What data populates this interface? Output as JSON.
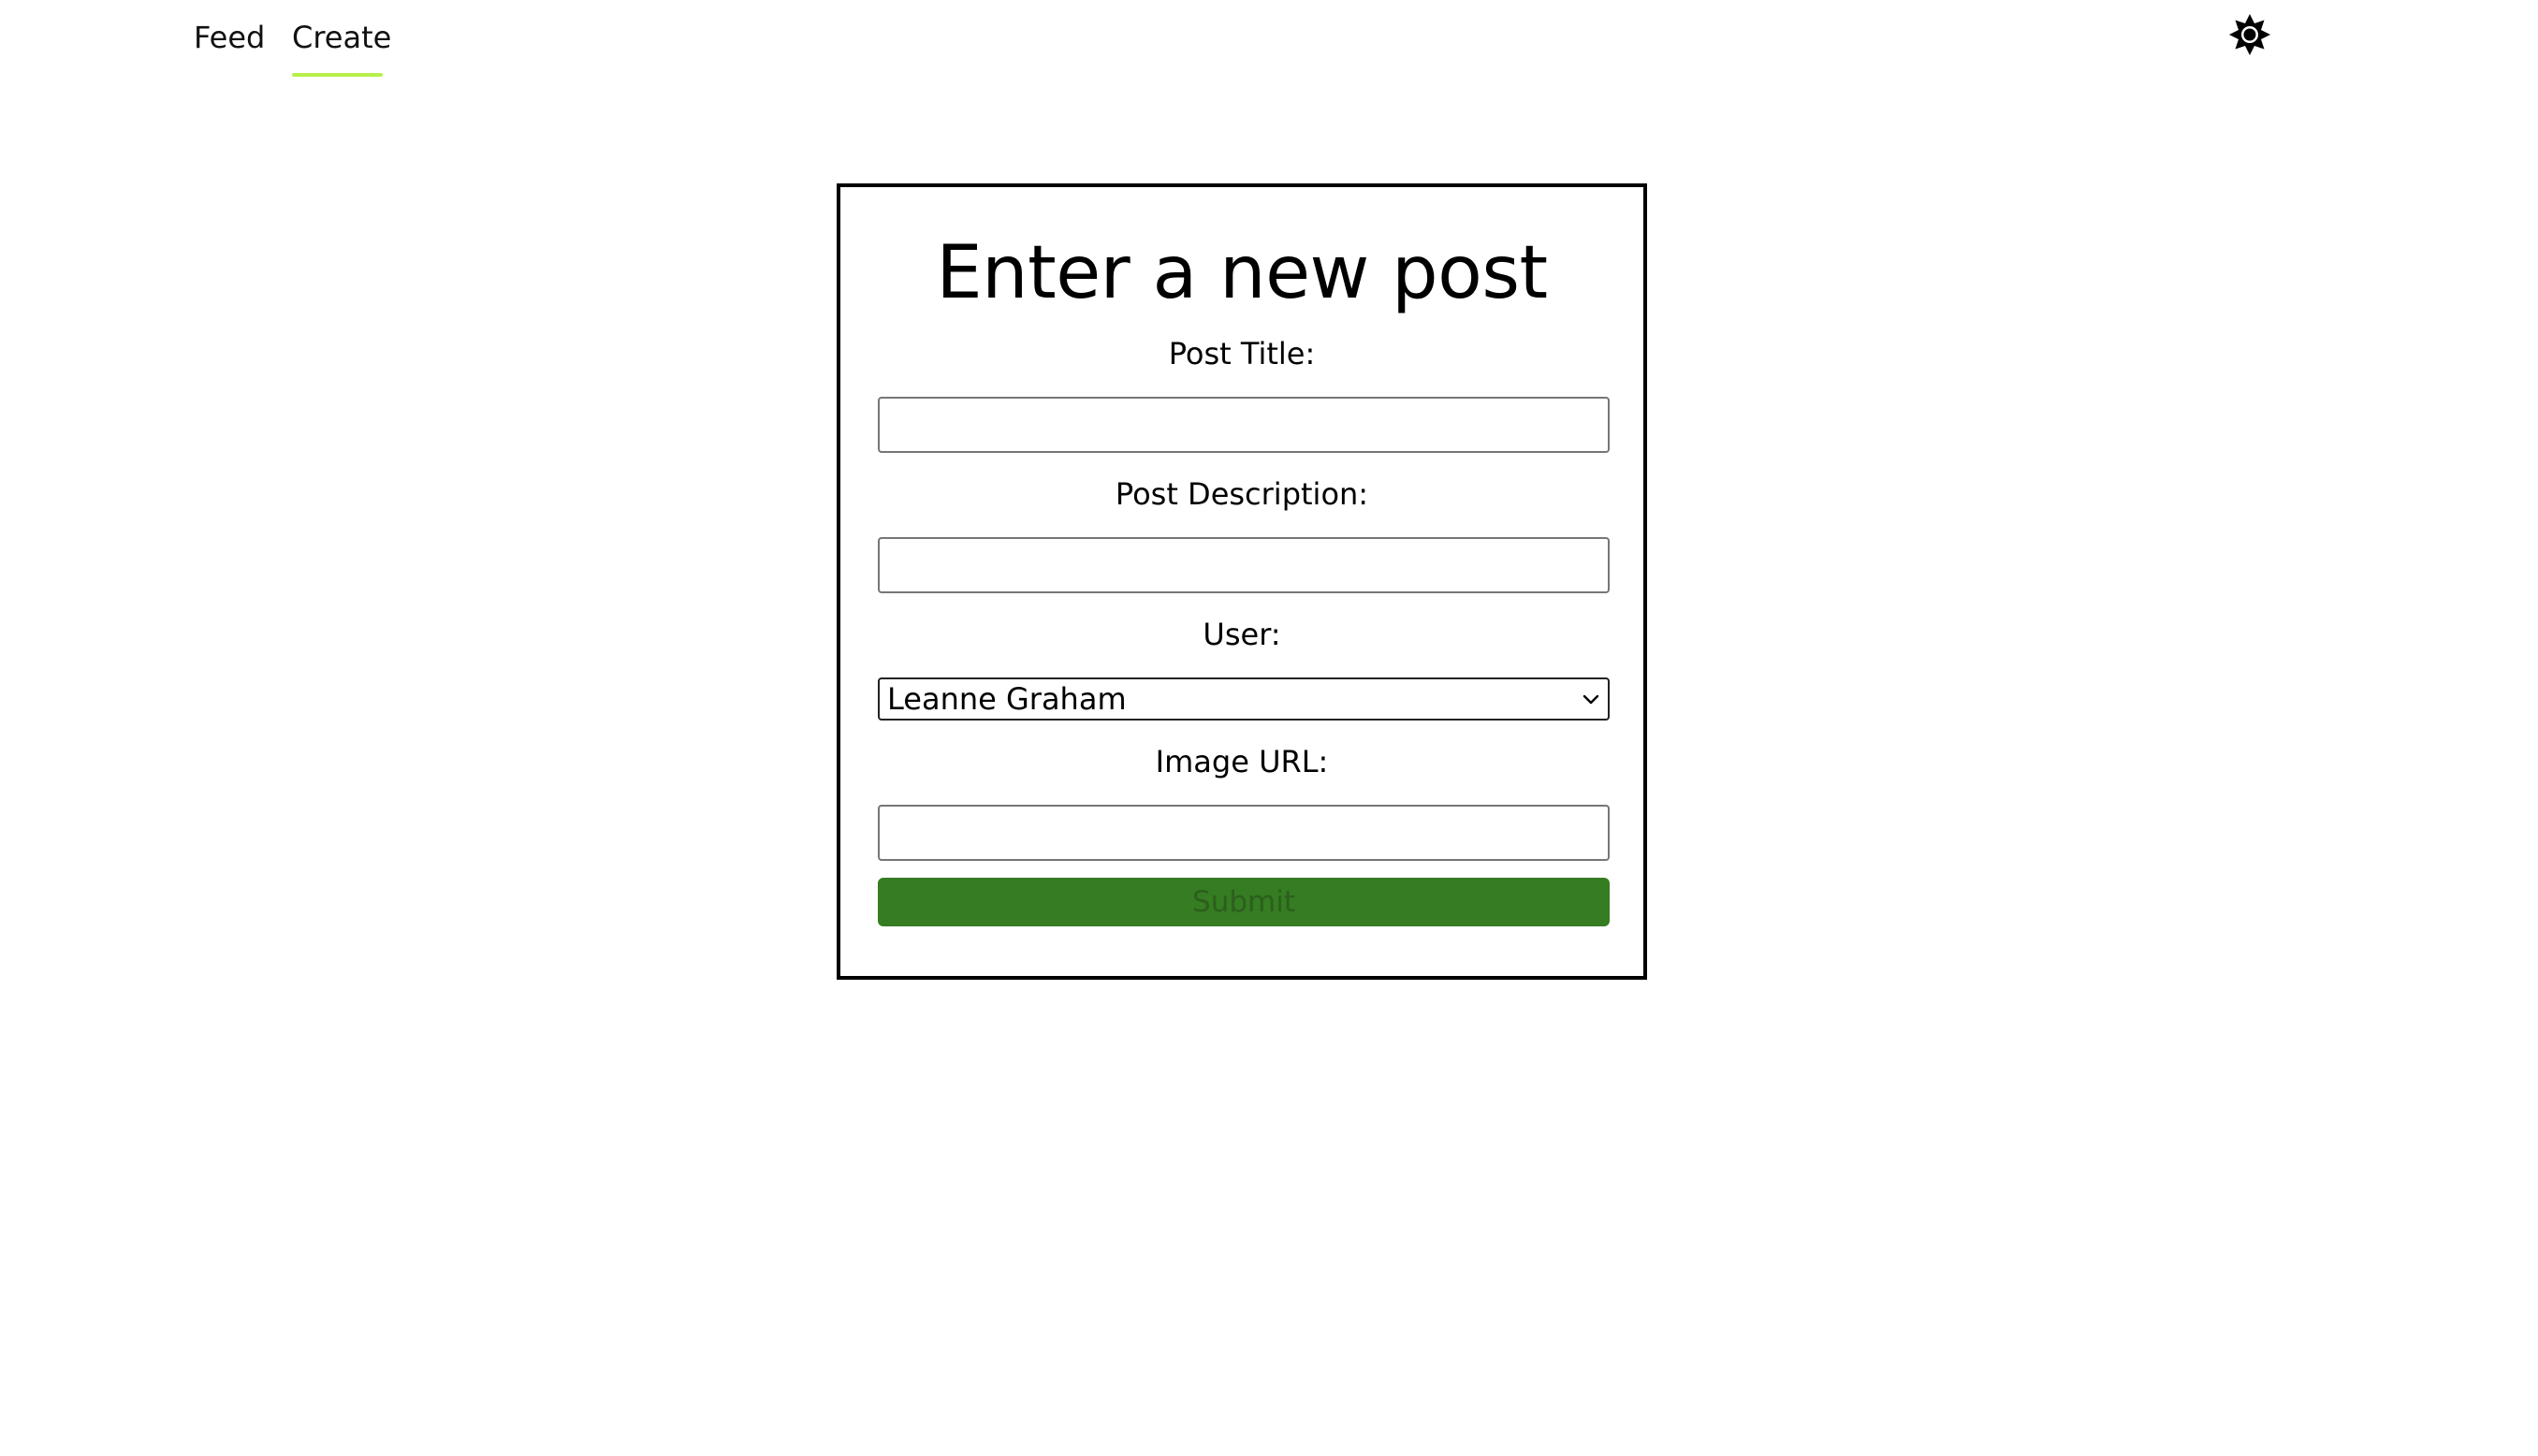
{
  "nav": {
    "feed_label": "Feed",
    "create_label": "Create",
    "active_tab": "Create",
    "underline_color": "#b8f04a",
    "theme_icon": "sun-gear-icon"
  },
  "form": {
    "title": "Enter a new post",
    "post_title": {
      "label": "Post Title:",
      "value": "",
      "placeholder": ""
    },
    "post_description": {
      "label": "Post Description:",
      "value": "",
      "placeholder": ""
    },
    "user": {
      "label": "User:",
      "selected": "Leanne Graham",
      "icon": "chevron-down-icon"
    },
    "image_url": {
      "label": "Image URL:",
      "value": "",
      "placeholder": ""
    },
    "submit_label": "Submit",
    "submit_bg_color": "#357c22",
    "submit_text_color": "#2c5f1c"
  }
}
